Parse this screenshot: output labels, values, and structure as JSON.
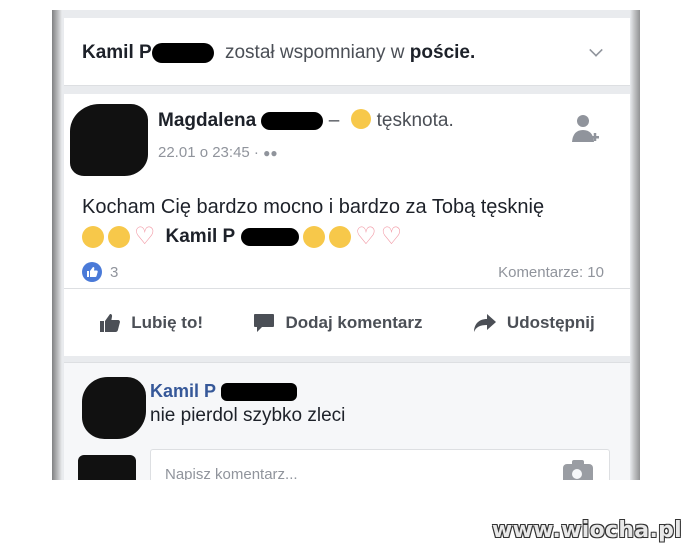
{
  "notice": {
    "name": "Kamil P",
    "action": "został wspomniany w",
    "target": "poście."
  },
  "post": {
    "author": "Magdalena",
    "feeling_sep": "–",
    "feeling": "tęsknota.",
    "timestamp": "22.01 o 23:45 ·",
    "text": "Kocham Cię bardzo mocno i bardzo za Tobą tęsknię",
    "tagged": "Kamil P",
    "likes_count": "3",
    "comments_label": "Komentarze: 10"
  },
  "actions": {
    "like": "Lubię to!",
    "comment": "Dodaj komentarz",
    "share": "Udostępnij"
  },
  "comment": {
    "author": "Kamil P",
    "text": "nie pierdol szybko zleci"
  },
  "comment_input": {
    "placeholder": "Napisz komentarz..."
  },
  "watermark": "www.wiocha.pl",
  "colors": {
    "link": "#365899",
    "like_blue": "#4a7ad8",
    "heart": "#f29aa6",
    "emoji": "#f7c84a"
  }
}
